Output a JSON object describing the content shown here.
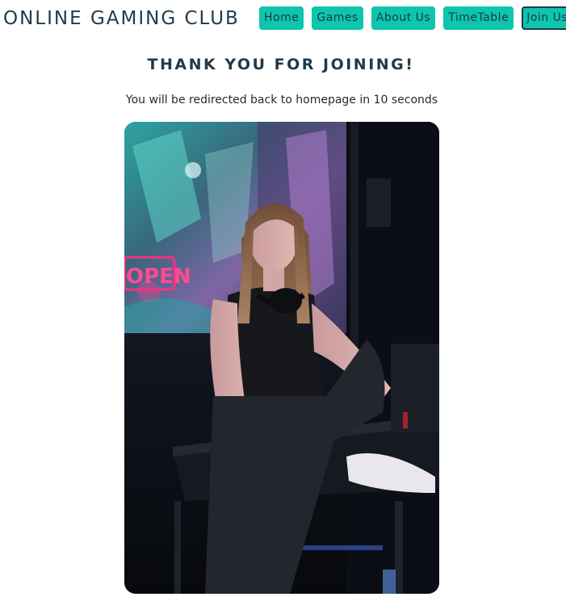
{
  "header": {
    "title": "ONLINE GAMING CLUB",
    "nav": [
      {
        "label": "Home"
      },
      {
        "label": "Games"
      },
      {
        "label": "About Us"
      },
      {
        "label": "TimeTable"
      },
      {
        "label": "Join Us"
      }
    ]
  },
  "main": {
    "headline": "THANK YOU FOR JOINING!",
    "redirect_text": "You will be redirected back to homepage in 10 seconds",
    "photo": {
      "neon_sign_text": "OPEN"
    }
  },
  "colors": {
    "accent": "#0ec5ae",
    "text": "#1f3a4a"
  }
}
